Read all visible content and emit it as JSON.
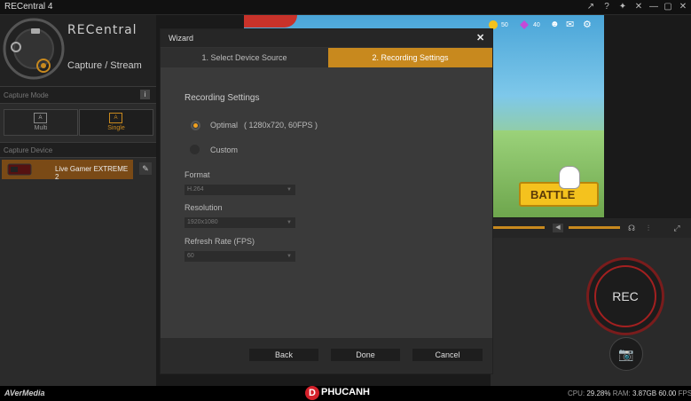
{
  "window": {
    "title": "RECentral 4",
    "buttons": [
      "↗",
      "?",
      "✦",
      "✕",
      "—",
      "▢",
      "✕"
    ]
  },
  "sidebar": {
    "brand": "RECentral",
    "mode_title": "Capture / Stream",
    "capture_mode_label": "Capture Mode",
    "info_icon": "i",
    "modes": [
      {
        "label": "Multi",
        "icon": "A"
      },
      {
        "label": "Single",
        "icon": "A"
      }
    ],
    "capture_device_label": "Capture Device",
    "device_name": "Live Gamer EXTREME 2",
    "footer_brand": "AVerMedia"
  },
  "game": {
    "coins": "50",
    "gems": "40",
    "battle": "BATTLE"
  },
  "wizard": {
    "title": "Wizard",
    "close": "✕",
    "tabs": [
      {
        "label": "1. Select Device Source",
        "active": false
      },
      {
        "label": "2. Recording Settings",
        "active": true
      }
    ],
    "section_title": "Recording Settings",
    "options": [
      {
        "label": "Optimal",
        "detail": "( 1280x720, 60FPS )",
        "selected": true
      },
      {
        "label": "Custom",
        "detail": "",
        "selected": false
      }
    ],
    "format_label": "Format",
    "format_value": "H.264",
    "resolution_label": "Resolution",
    "resolution_value": "1920x1080",
    "refresh_label": "Refresh Rate (FPS)",
    "refresh_value": "60",
    "buttons": {
      "back": "Back",
      "done": "Done",
      "cancel": "Cancel"
    }
  },
  "rec": {
    "label": "REC"
  },
  "status": {
    "cpu_label": "CPU:",
    "cpu_value": "29.28%",
    "ram_label": "RAM:",
    "ram_value": "3.87GB",
    "fps_value": "60.00",
    "fps_label": "FPS",
    "watermark": "PHUCANH"
  },
  "colors": {
    "accent": "#c8891e",
    "panel": "#2b2b2b",
    "dialog": "#3a3a3a"
  }
}
